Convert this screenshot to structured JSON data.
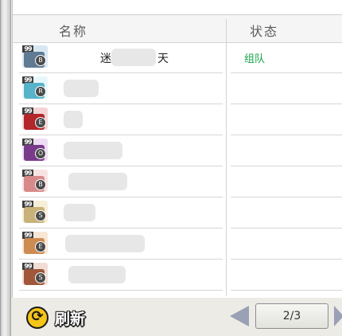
{
  "table": {
    "headers": {
      "name": "名称",
      "status": "状态"
    },
    "rows": [
      {
        "name": "迷",
        "name_tail": "天",
        "status": "组队",
        "level": "99",
        "tier": "B",
        "portrait": "#5f7a93",
        "accent": "#d9e7f2"
      },
      {
        "name": "",
        "status": "",
        "level": "99",
        "tier": "R",
        "portrait": "#57b3c9",
        "accent": "#e6f7fb"
      },
      {
        "name": "",
        "status": "",
        "level": "99",
        "tier": "E",
        "portrait": "#b3262a",
        "accent": "#f3d5d5"
      },
      {
        "name": "",
        "status": "",
        "level": "99",
        "tier": "O",
        "portrait": "#7a3a8c",
        "accent": "#eedcf4"
      },
      {
        "name": "",
        "status": "",
        "level": "99",
        "tier": "B",
        "portrait": "#d88a8a",
        "accent": "#f8e3e3"
      },
      {
        "name": "",
        "status": "",
        "level": "99",
        "tier": "S",
        "portrait": "#c8b27a",
        "accent": "#f6efd8"
      },
      {
        "name": "",
        "status": "",
        "level": "99",
        "tier": "E",
        "portrait": "#cc8c52",
        "accent": "#f8e6d4"
      },
      {
        "name": "",
        "status": "",
        "level": "99",
        "tier": "S",
        "portrait": "#a0573a",
        "accent": "#f1ddd3"
      }
    ]
  },
  "footer": {
    "refresh_label": "刷新",
    "pagination": "2/3"
  },
  "colors": {
    "status_green": "#16a34a",
    "panel_bg": "#ffffff",
    "chrome_bg": "#ecebe6",
    "arrow": "#9aa0b5"
  }
}
